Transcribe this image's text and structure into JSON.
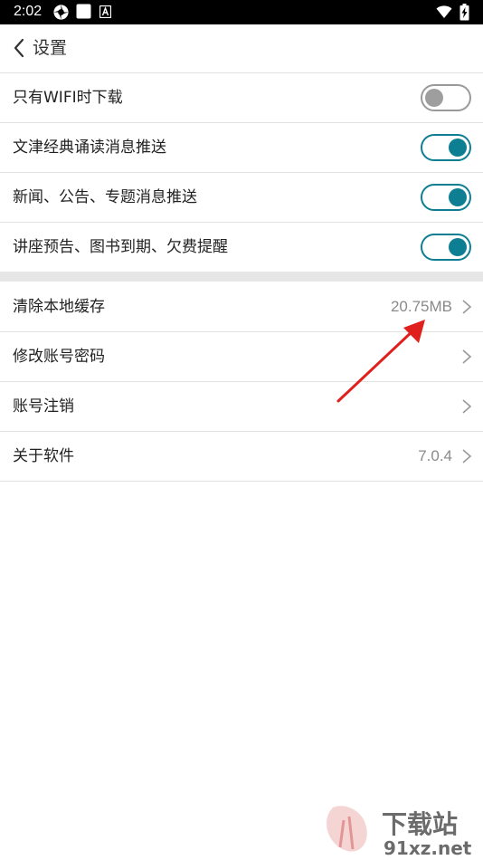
{
  "status_bar": {
    "time": "2:02",
    "icons": [
      "settings-wheel-icon",
      "notification-square-icon",
      "a-badge-icon",
      "wifi-icon",
      "battery-charging-icon"
    ]
  },
  "header": {
    "back_icon": "chevron-left-icon",
    "title": "设置"
  },
  "toggles": [
    {
      "label": "只有WIFI时下载",
      "state": "off"
    },
    {
      "label": "文津经典诵读消息推送",
      "state": "on"
    },
    {
      "label": "新闻、公告、专题消息推送",
      "state": "on"
    },
    {
      "label": "讲座预告、图书到期、欠费提醒",
      "state": "on"
    }
  ],
  "menu": [
    {
      "label": "清除本地缓存",
      "value": "20.75MB"
    },
    {
      "label": "修改账号密码",
      "value": ""
    },
    {
      "label": "账号注销",
      "value": ""
    },
    {
      "label": "关于软件",
      "value": "7.0.4"
    }
  ],
  "watermark": {
    "brand": "下载站",
    "domain": "91xz.net"
  },
  "colors": {
    "accent": "#0e7f92",
    "annotation_arrow": "#e0201c",
    "toggle_off": "#9e9e9e"
  }
}
